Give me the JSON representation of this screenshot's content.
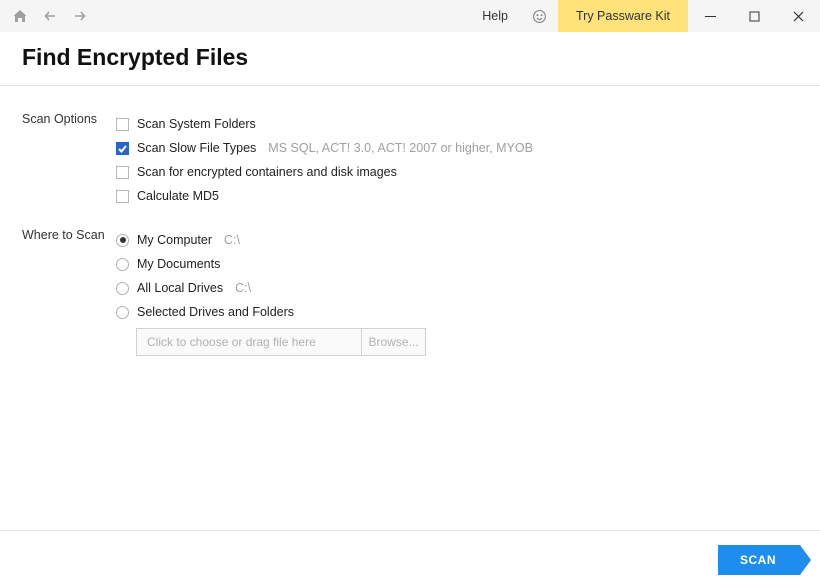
{
  "titlebar": {
    "help_label": "Help",
    "try_label": "Try Passware Kit"
  },
  "header": {
    "title": "Find Encrypted Files"
  },
  "scan_options": {
    "section_label": "Scan Options",
    "items": [
      {
        "label": "Scan System Folders",
        "hint": "",
        "checked": false
      },
      {
        "label": "Scan Slow File Types",
        "hint": "MS SQL, ACT! 3.0, ACT! 2007 or higher, MYOB",
        "checked": true
      },
      {
        "label": "Scan for encrypted containers and disk images",
        "hint": "",
        "checked": false
      },
      {
        "label": "Calculate MD5",
        "hint": "",
        "checked": false
      }
    ]
  },
  "where_to_scan": {
    "section_label": "Where to Scan",
    "items": [
      {
        "label": "My Computer",
        "hint": "C:\\",
        "selected": true
      },
      {
        "label": "My Documents",
        "hint": "",
        "selected": false
      },
      {
        "label": "All Local Drives",
        "hint": "C:\\",
        "selected": false
      },
      {
        "label": "Selected Drives and Folders",
        "hint": "",
        "selected": false
      }
    ],
    "path_placeholder": "Click to choose or drag file here",
    "browse_label": "Browse..."
  },
  "footer": {
    "scan_label": "SCAN"
  }
}
